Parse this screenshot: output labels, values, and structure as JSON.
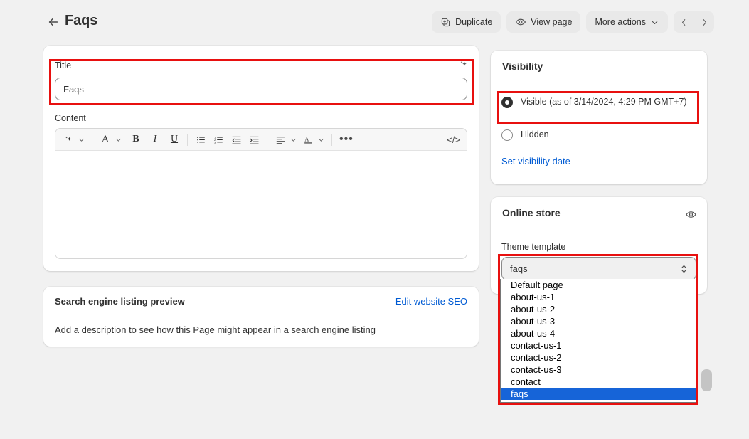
{
  "header": {
    "back_icon": "arrow-left-icon",
    "title": "Faqs",
    "duplicate_label": "Duplicate",
    "duplicate_icon": "duplicate-icon",
    "view_page_label": "View page",
    "view_page_icon": "eye-icon",
    "more_actions_label": "More actions",
    "more_actions_icon": "chevron-down-icon",
    "prev_icon": "chevron-left-icon",
    "next_icon": "chevron-right-icon"
  },
  "main_card": {
    "title_label": "Title",
    "title_value": "Faqs",
    "magic_icon": "sparkle-icon",
    "content_label": "Content",
    "toolbar": {
      "magic": "sparkle-icon",
      "magic_caret": "chevron-down-icon",
      "font_size": "A",
      "font_size_caret": "chevron-down-icon",
      "bold": "B",
      "italic": "I",
      "underline": "U",
      "bulleted_list": "bulleted-list-icon",
      "numbered_list": "numbered-list-icon",
      "outdent": "outdent-icon",
      "indent": "indent-icon",
      "align": "align-left-icon",
      "align_caret": "chevron-down-icon",
      "text_color": "A",
      "text_color_caret": "chevron-down-icon",
      "more": "•••",
      "code": "</>"
    },
    "editor_value": ""
  },
  "seo_card": {
    "heading": "Search engine listing preview",
    "edit_link": "Edit website SEO",
    "description": "Add a description to see how this Page might appear in a search engine listing"
  },
  "visibility_card": {
    "heading": "Visibility",
    "options": [
      {
        "label": "Visible (as of 3/14/2024, 4:29 PM GMT+7)",
        "selected": true
      },
      {
        "label": "Hidden",
        "selected": false
      }
    ],
    "set_date_link": "Set visibility date"
  },
  "online_store_card": {
    "heading": "Online store",
    "preview_icon": "eye-icon",
    "field_label": "Theme template",
    "selected_value": "faqs",
    "select_caret": "select-chevron-icon",
    "options": [
      {
        "label": "Default page",
        "selected": false
      },
      {
        "label": "about-us-1",
        "selected": false
      },
      {
        "label": "about-us-2",
        "selected": false
      },
      {
        "label": "about-us-3",
        "selected": false
      },
      {
        "label": "about-us-4",
        "selected": false
      },
      {
        "label": "contact-us-1",
        "selected": false
      },
      {
        "label": "contact-us-2",
        "selected": false
      },
      {
        "label": "contact-us-3",
        "selected": false
      },
      {
        "label": "contact",
        "selected": false
      },
      {
        "label": "faqs",
        "selected": true
      }
    ]
  },
  "annotations": {
    "highlight_color": "#e8100f",
    "boxes": [
      "title-field",
      "visible-radio-option",
      "theme-template-dropdown"
    ]
  },
  "colors": {
    "page_background": "#f1f1f1",
    "card_background": "#ffffff",
    "link": "#005bd3",
    "text": "#303030",
    "selection": "#1664d8"
  }
}
